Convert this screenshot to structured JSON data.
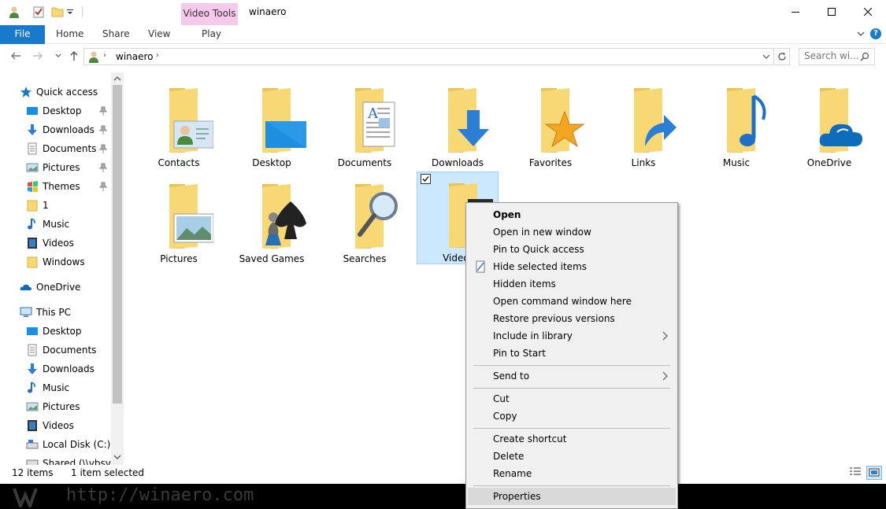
{
  "window": {
    "title": "winaero",
    "contextual_tab_group": "Video Tools"
  },
  "ribbon": {
    "file_label": "File",
    "tabs": [
      "Home",
      "Share",
      "View",
      "Play"
    ]
  },
  "address": {
    "location": "winaero",
    "search_placeholder": "Search wi..."
  },
  "nav_pane": {
    "items": [
      {
        "label": "Quick access",
        "icon": "star-icon",
        "pinned": false
      },
      {
        "label": "Desktop",
        "icon": "desktop-icon",
        "pinned": true
      },
      {
        "label": "Downloads",
        "icon": "downloads-icon",
        "pinned": true
      },
      {
        "label": "Documents",
        "icon": "documents-icon",
        "pinned": true
      },
      {
        "label": "Pictures",
        "icon": "pictures-icon",
        "pinned": true
      },
      {
        "label": "Themes",
        "icon": "themes-icon",
        "pinned": true
      },
      {
        "label": "1",
        "icon": "folder-icon",
        "pinned": false
      },
      {
        "label": "Music",
        "icon": "music-icon",
        "pinned": false
      },
      {
        "label": "Videos",
        "icon": "videos-icon",
        "pinned": false
      },
      {
        "label": "Windows",
        "icon": "folder-icon",
        "pinned": false
      },
      {
        "label": "OneDrive",
        "icon": "onedrive-icon",
        "pinned": false
      },
      {
        "label": "This PC",
        "icon": "computer-icon",
        "pinned": false
      },
      {
        "label": "Desktop",
        "icon": "desktop-icon",
        "pinned": false
      },
      {
        "label": "Documents",
        "icon": "documents-icon",
        "pinned": false
      },
      {
        "label": "Downloads",
        "icon": "downloads-icon",
        "pinned": false
      },
      {
        "label": "Music",
        "icon": "music-icon",
        "pinned": false
      },
      {
        "label": "Pictures",
        "icon": "pictures-icon",
        "pinned": false
      },
      {
        "label": "Videos",
        "icon": "videos-icon",
        "pinned": false
      },
      {
        "label": "Local Disk (C:)",
        "icon": "disk-icon",
        "pinned": false
      },
      {
        "label": "Shared (\\\\vbsvr",
        "icon": "network-drive-icon",
        "pinned": false
      }
    ]
  },
  "content": {
    "items": [
      {
        "label": "Contacts",
        "overlay": "contacts"
      },
      {
        "label": "Desktop",
        "overlay": "desktop"
      },
      {
        "label": "Documents",
        "overlay": "documents"
      },
      {
        "label": "Downloads",
        "overlay": "downloads"
      },
      {
        "label": "Favorites",
        "overlay": "favorites"
      },
      {
        "label": "Links",
        "overlay": "links"
      },
      {
        "label": "Music",
        "overlay": "music"
      },
      {
        "label": "OneDrive",
        "overlay": "onedrive"
      },
      {
        "label": "Pictures",
        "overlay": "pictures"
      },
      {
        "label": "Saved Games",
        "overlay": "savedgames"
      },
      {
        "label": "Searches",
        "overlay": "searches"
      },
      {
        "label": "Videos",
        "overlay": "videos",
        "selected": true
      }
    ]
  },
  "status": {
    "count": "12 items",
    "selected": "1 item selected"
  },
  "context_menu": {
    "items": [
      "Open",
      "Open in new window",
      "Pin to Quick access",
      "Hide selected items",
      "Hidden items",
      "Open command window here",
      "Restore previous versions",
      "Include in library",
      "Pin to Start",
      "Send to",
      "Cut",
      "Copy",
      "Create shortcut",
      "Delete",
      "Rename",
      "Properties"
    ]
  },
  "watermark": "http://winaero.com",
  "colors": {
    "accent": "#1979ca",
    "selection": "#cce8ff",
    "folder": "#f8d775",
    "contextual_tab": "#f5c8ec"
  }
}
